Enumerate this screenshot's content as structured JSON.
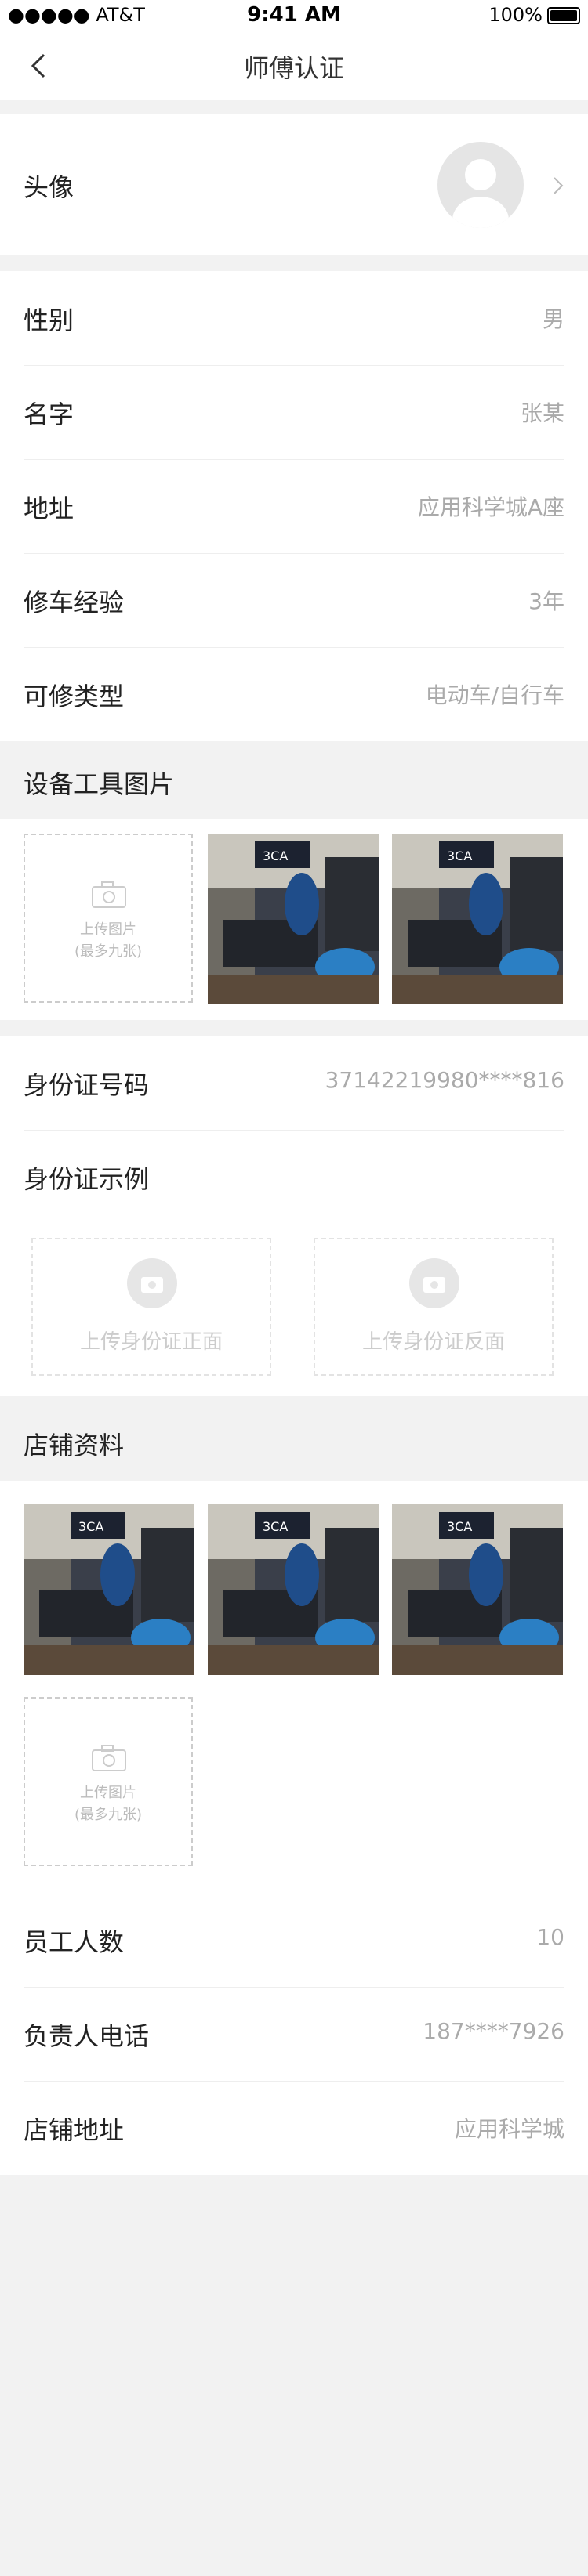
{
  "status_bar": {
    "carrier": "●●●●● AT&T",
    "time": "9:41 AM",
    "battery": "100%"
  },
  "nav": {
    "title": "师傅认证"
  },
  "avatar_row": {
    "label": "头像"
  },
  "info": [
    {
      "label": "性别",
      "value": "男"
    },
    {
      "label": "名字",
      "value": "张某"
    },
    {
      "label": "地址",
      "value": "应用科学城A座"
    },
    {
      "label": "修车经验",
      "value": "3年"
    },
    {
      "label": "可修类型",
      "value": "电动车/自行车"
    }
  ],
  "equipment": {
    "title": "设备工具图片",
    "upload_line1": "上传图片",
    "upload_line2": "(最多九张)"
  },
  "id_card": {
    "number_label": "身份证号码",
    "number_value": "37142219980****816",
    "example_label": "身份证示例",
    "front_label": "上传身份证正面",
    "back_label": "上传身份证反面"
  },
  "store": {
    "title": "店铺资料",
    "upload_line1": "上传图片",
    "upload_line2": "(最多九张)",
    "rows": [
      {
        "label": "员工人数",
        "value": "10"
      },
      {
        "label": "负责人电话",
        "value": "187****7926"
      },
      {
        "label": "店铺地址",
        "value": "应用科学城"
      }
    ]
  }
}
